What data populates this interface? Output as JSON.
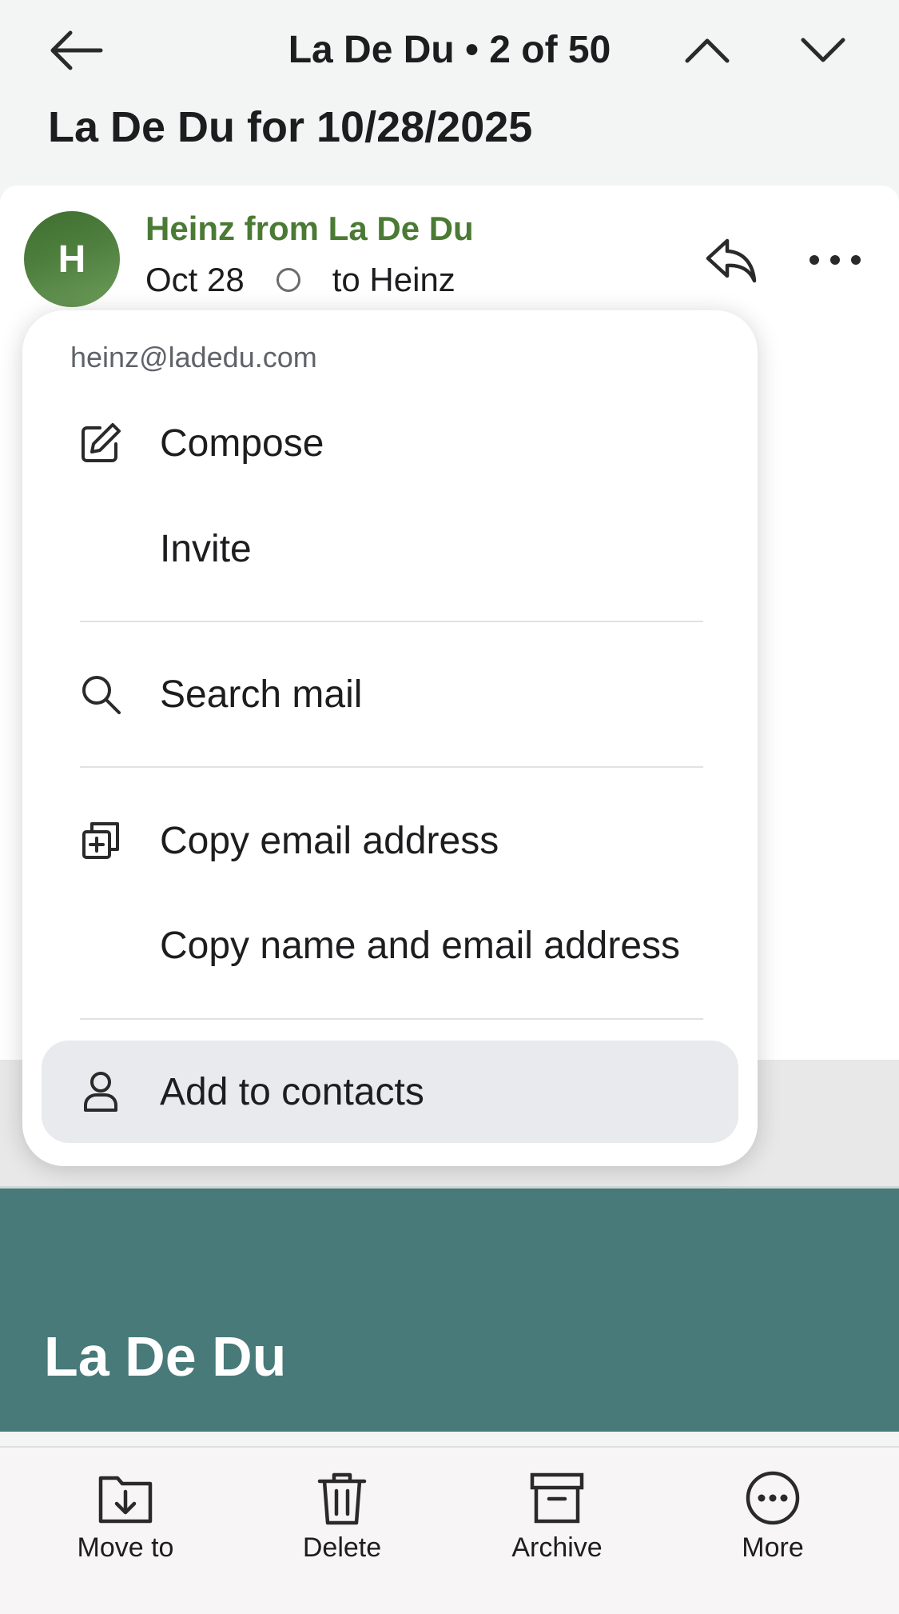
{
  "nav": {
    "title": "La De Du • 2 of 50"
  },
  "subject": "La De Du for 10/28/2025",
  "message": {
    "avatar_initial": "H",
    "sender": "Heinz from La De Du",
    "date": "Oct 28",
    "recipient": "to Heinz"
  },
  "popup": {
    "email": "heinz@ladedu.com",
    "items": [
      {
        "label": "Compose",
        "icon": "compose-icon"
      },
      {
        "label": "Invite",
        "icon": ""
      },
      {
        "label": "Search mail",
        "icon": "search-icon"
      },
      {
        "label": "Copy email address",
        "icon": "copy-icon"
      },
      {
        "label": "Copy name and email address",
        "icon": ""
      },
      {
        "label": "Add to contacts",
        "icon": "person-icon"
      }
    ]
  },
  "banner": {
    "title": "La De Du"
  },
  "toolbar": {
    "move_label": "Move to",
    "delete_label": "Delete",
    "archive_label": "Archive",
    "more_label": "More"
  },
  "colors": {
    "sender": "#4a7a34",
    "banner": "#477a79",
    "highlight": "#e9eaed"
  }
}
